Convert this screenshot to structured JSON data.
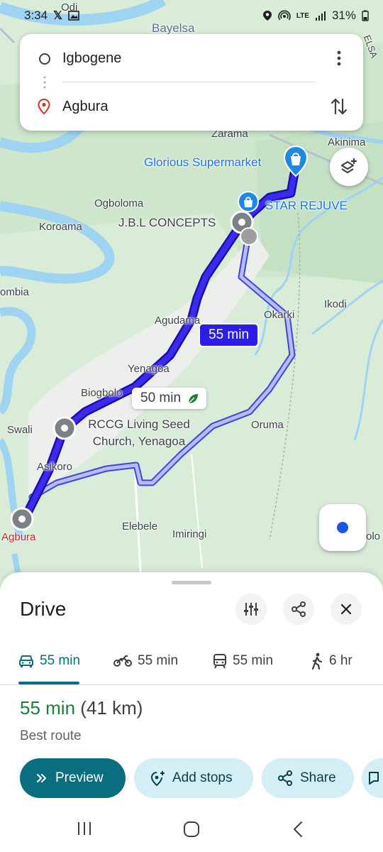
{
  "status_bar": {
    "time": "3:34",
    "battery": "31%",
    "network": "LTE"
  },
  "search": {
    "origin": "Igbogene",
    "destination": "Agbura"
  },
  "map": {
    "labels": {
      "odi": "Odi",
      "bayelsa": "Bayelsa",
      "elsa": "ELSA",
      "zarama": "Zarama",
      "akinima": "Akinima",
      "glorious": "Glorious Supermarket",
      "star": "STAR REJUVE",
      "jbl": "J.B.L CONCEPTS",
      "ogboloma": "Ogboloma",
      "koroama": "Koroama",
      "ombia": "ombia",
      "okarki": "Okarki",
      "ikodi": "Ikodi",
      "agudama": "Agudama",
      "yenagoa": "Yenagoa",
      "biogbolo": "Biogbolo",
      "rccg": "RCCG Living Seed Church, Yenagoa",
      "swali": "Swali",
      "oruma": "Oruma",
      "asikoro": "Asikoro",
      "agbura": "Agbura",
      "elebele": "Elebele",
      "imiringi": "Imiringi",
      "olo": "olo"
    },
    "route_main_time": "55 min",
    "route_alt_time": "50 min"
  },
  "sheet": {
    "title": "Drive",
    "modes": [
      {
        "label": "55 min",
        "icon": "car-icon"
      },
      {
        "label": "55 min",
        "icon": "motorcycle-icon"
      },
      {
        "label": "55 min",
        "icon": "transit-icon"
      },
      {
        "label": "6 hr",
        "icon": "walk-icon"
      }
    ],
    "summary_duration": "55 min",
    "summary_distance": "(41 km)",
    "best_route": "Best route",
    "actions": {
      "preview": "Preview",
      "add_stops": "Add stops",
      "share": "Share"
    }
  },
  "colors": {
    "route_main": "#2c1ee8",
    "route_alt": "#6b73f2",
    "accent": "#0b6e7f",
    "best_green": "#188038"
  }
}
